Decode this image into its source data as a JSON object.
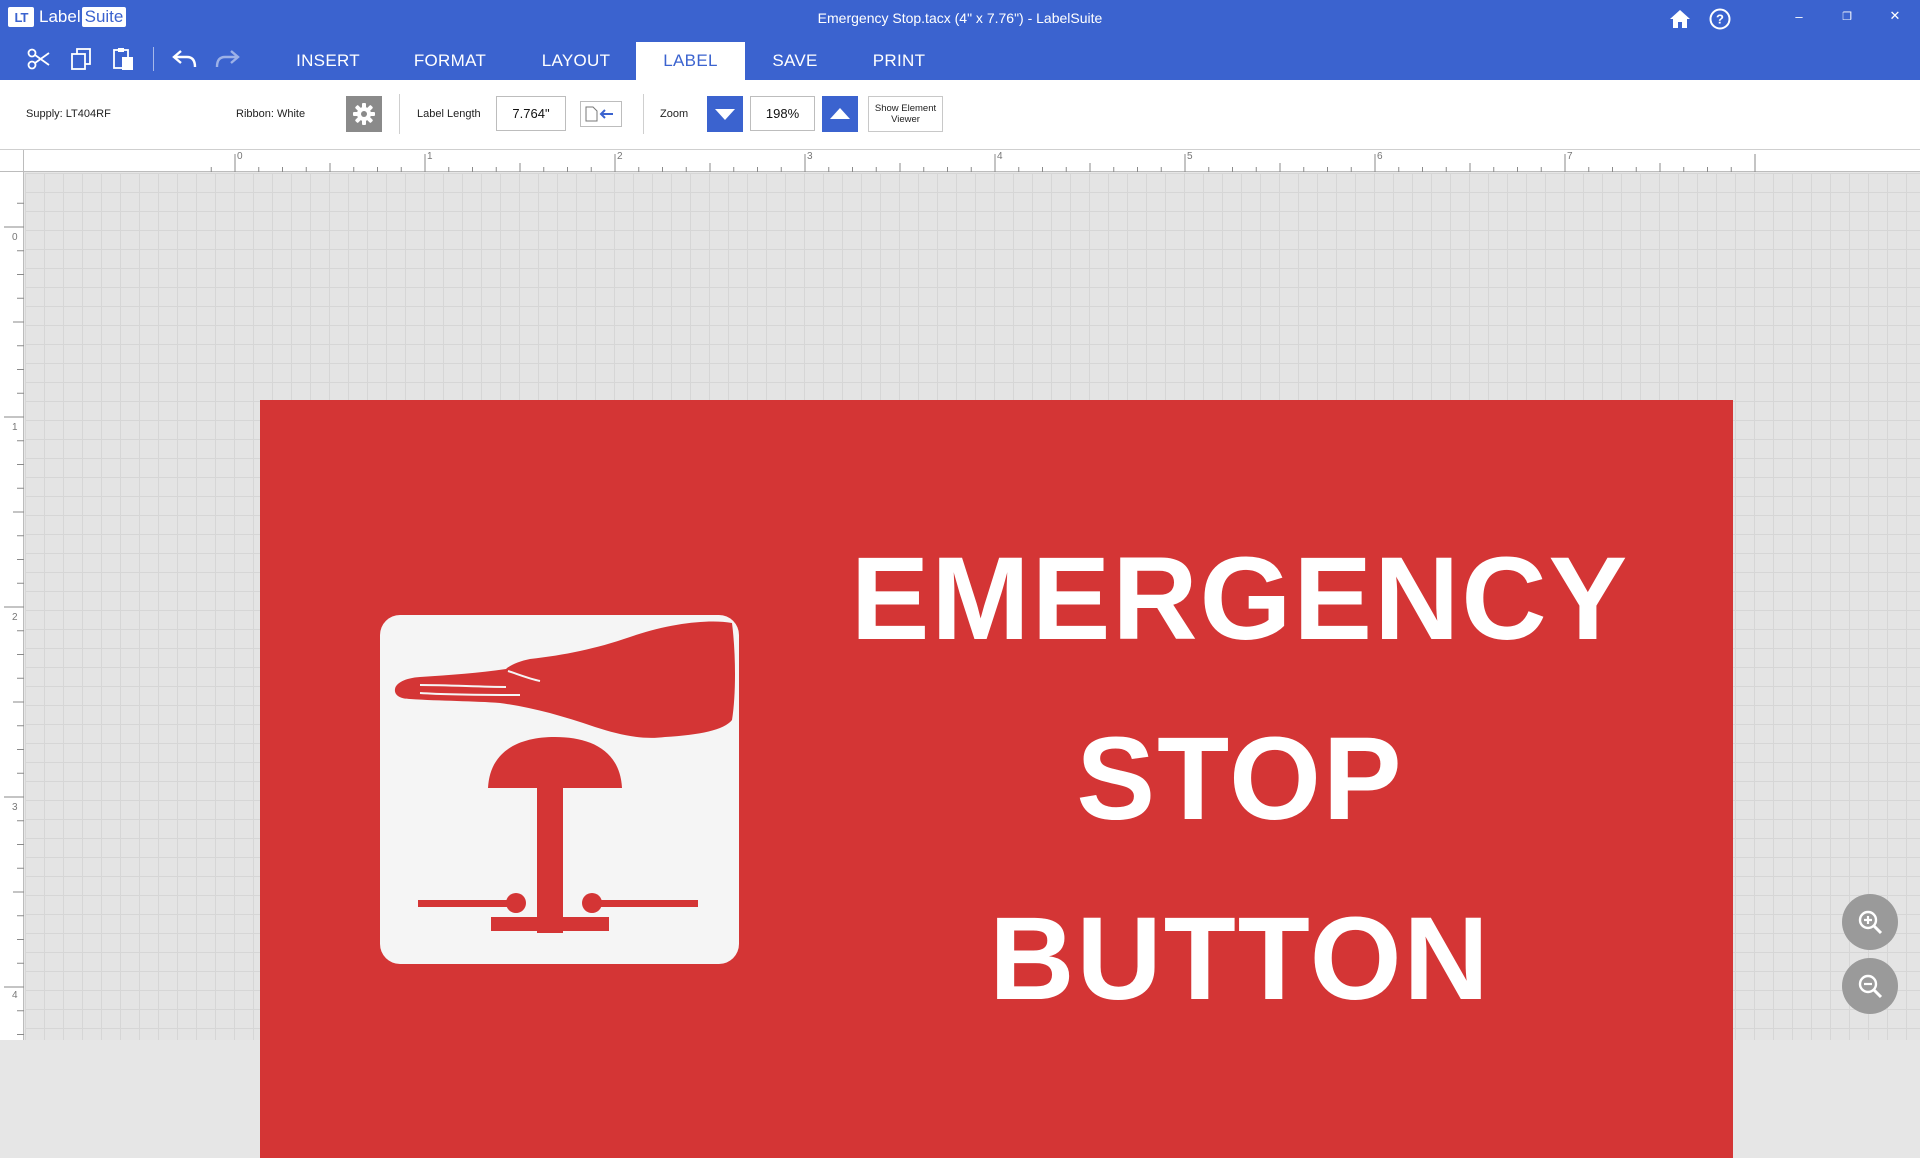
{
  "app": {
    "logo_lt": "LT",
    "logo_label": "Label",
    "logo_suite": "Suite",
    "window_title": "Emergency Stop.tacx (4\" x 7.76\") - LabelSuite"
  },
  "title_icons": [
    "home-icon",
    "help-icon"
  ],
  "window_controls": {
    "minimize": "–",
    "restore": "❐",
    "close": "✕"
  },
  "toolbar": {
    "quick_tools": [
      "cut-icon",
      "copy-icon",
      "paste-icon",
      "undo-icon",
      "redo-icon"
    ],
    "tabs": [
      {
        "label": "INSERT",
        "active": false
      },
      {
        "label": "FORMAT",
        "active": false
      },
      {
        "label": "LAYOUT",
        "active": false
      },
      {
        "label": "LABEL",
        "active": true
      },
      {
        "label": "SAVE",
        "active": false
      },
      {
        "label": "PRINT",
        "active": false
      }
    ]
  },
  "properties": {
    "supply": "Supply: LT404RF",
    "ribbon": "Ribbon: White",
    "label_length_label": "Label Length",
    "label_length_value": "7.764\"",
    "zoom_label": "Zoom",
    "zoom_value": "198%",
    "show_element_viewer": "Show Element Viewer"
  },
  "rulers": {
    "horizontal": [
      "0",
      "1",
      "2",
      "3",
      "4",
      "5",
      "6",
      "7"
    ],
    "vertical": [
      "0",
      "1",
      "2",
      "3",
      "4"
    ]
  },
  "label_design": {
    "background_color": "#d43535",
    "text_color": "#ffffff",
    "lines": [
      "EMERGENCY",
      "STOP",
      "BUTTON"
    ],
    "icon": "emergency-stop-hand-icon"
  },
  "colors": {
    "accent": "#3b63cf",
    "canvas": "#e4e4e4"
  }
}
